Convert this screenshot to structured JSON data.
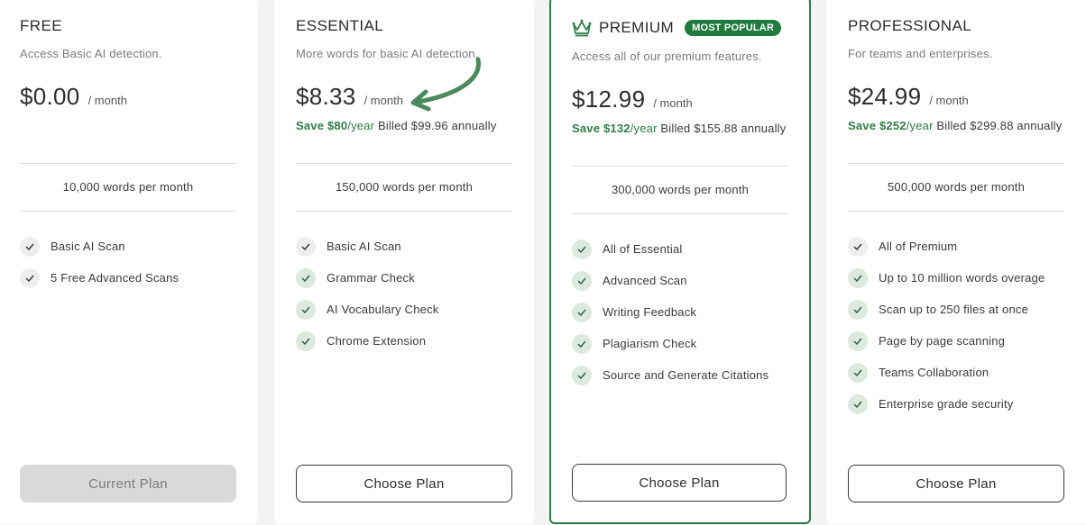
{
  "plans": [
    {
      "name": "FREE",
      "description": "Access Basic AI detection.",
      "price": "$0.00",
      "per": "/ month",
      "words": "10,000 words per month",
      "features": [
        "Basic AI Scan",
        "5 Free Advanced Scans"
      ],
      "button": "Current Plan"
    },
    {
      "name": "ESSENTIAL",
      "description": "More words for basic AI detection.",
      "price": "$8.33",
      "per": "/ month",
      "save": "Save $80",
      "save_year": "/year",
      "billed": "Billed $99.96 annually",
      "words": "150,000 words per month",
      "features": [
        "Basic AI Scan",
        "Grammar Check",
        "AI Vocabulary Check",
        "Chrome Extension"
      ],
      "button": "Choose Plan"
    },
    {
      "name": "PREMIUM",
      "badge": "MOST POPULAR",
      "description": "Access all of our premium features.",
      "price": "$12.99",
      "per": "/ month",
      "save": "Save $132",
      "save_year": "/year",
      "billed": "Billed $155.88 annually",
      "words": "300,000 words per month",
      "features": [
        "All of Essential",
        "Advanced Scan",
        "Writing Feedback",
        "Plagiarism Check",
        "Source and Generate Citations"
      ],
      "button": "Choose Plan"
    },
    {
      "name": "PROFESSIONAL",
      "description": "For teams and enterprises.",
      "price": "$24.99",
      "per": "/ month",
      "save": "Save $252",
      "save_year": "/year",
      "billed": "Billed $299.88 annually",
      "words": "500,000 words per month",
      "features": [
        "All of Premium",
        "Up to 10 million words overage",
        "Scan up to 250 files at once",
        "Page by page scanning",
        "Teams Collaboration",
        "Enterprise grade security"
      ],
      "button": "Choose Plan"
    }
  ],
  "colors": {
    "accent_green": "#2f7d47",
    "badge_green": "#1e7a3d",
    "check_bg": "#dbe9df",
    "current_button_bg": "#d9d9d9"
  },
  "icons": {
    "premium_title": "crown-icon",
    "feature": "check-icon",
    "annotation": "curved-arrow-icon"
  }
}
